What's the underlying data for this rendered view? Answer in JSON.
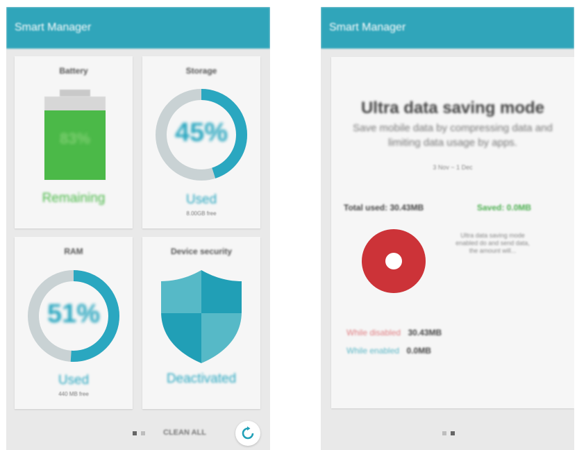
{
  "left_screen": {
    "app_title": "Smart Manager",
    "battery": {
      "title": "Battery",
      "percent_label": "83%",
      "percent": 83,
      "status": "Remaining"
    },
    "storage": {
      "title": "Storage",
      "percent_label": "45%",
      "percent": 45,
      "status": "Used",
      "detail": "8.00GB free"
    },
    "ram": {
      "title": "RAM",
      "percent_label": "51%",
      "percent": 51,
      "status": "Used",
      "detail": "440 MB free"
    },
    "security": {
      "title": "Device security",
      "status": "Deactivated"
    },
    "footer": {
      "clean_all_label": "CLEAN ALL",
      "refresh_icon": "refresh-icon",
      "active_page": 1
    }
  },
  "right_screen": {
    "app_title": "Smart Manager",
    "title": "Ultra data saving mode",
    "description": "Save mobile data by compressing data and limiting data usage by apps.",
    "period": "3 Nov ~ 1 Dec",
    "total_used": "Total used: 30.43MB",
    "saved": "Saved: 0.0MB",
    "side_note": "Ultra data saving mode enabled do and send data, the amount will...",
    "while_disabled_label": "While disabled",
    "while_disabled_value": "30.43MB",
    "while_enabled_label": "While enabled",
    "while_enabled_value": "0.0MB",
    "active_page": 2
  },
  "colors": {
    "accent": "#21a0b7",
    "ring_fill": "#2aa7c0",
    "ring_track": "#c9d2d4",
    "battery_green": "#4bb948",
    "pie_red": "#cc3338",
    "saved_green": "#4caf50"
  }
}
